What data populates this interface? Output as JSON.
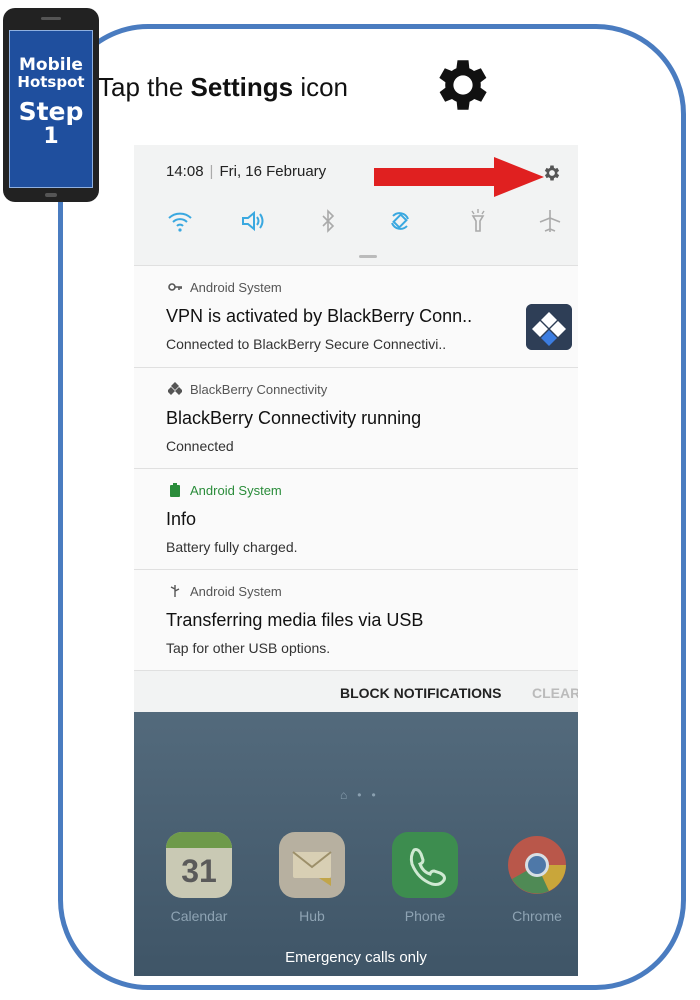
{
  "badge": {
    "line1": "Mobile",
    "line2": "Hotspot",
    "line3": "Step",
    "line4": "1"
  },
  "instruction": {
    "prefix": "Tap the ",
    "bold": "Settings",
    "suffix": " icon"
  },
  "status": {
    "time": "14:08",
    "date": "Fri, 16 February"
  },
  "quick_settings": [
    "wifi-icon",
    "sound-icon",
    "bluetooth-icon",
    "auto-rotate-icon",
    "flashlight-icon",
    "airplane-mode-icon"
  ],
  "notifications": [
    {
      "app": "Android System",
      "title": "VPN is activated by BlackBerry Conn..",
      "text": "Connected to BlackBerry Secure Connectivi.."
    },
    {
      "app": "BlackBerry Connectivity",
      "title": "BlackBerry Connectivity running",
      "text": "Connected"
    },
    {
      "app": "Android System",
      "title": "Info",
      "text": "Battery fully charged."
    },
    {
      "app": "Android System",
      "title": "Transferring media files via USB",
      "text": "Tap for other USB options."
    }
  ],
  "actions": {
    "block": "BLOCK NOTIFICATIONS",
    "clear": "CLEAR"
  },
  "home": {
    "calendar_day": "31",
    "apps": [
      "Calendar",
      "Hub",
      "Phone",
      "Chrome"
    ],
    "emergency": "Emergency calls only"
  },
  "colors": {
    "frame": "#4a7cc0",
    "badge": "#1f4f9e",
    "arrow": "#e02020",
    "quick_settings_accent": "#3aa8e0"
  }
}
